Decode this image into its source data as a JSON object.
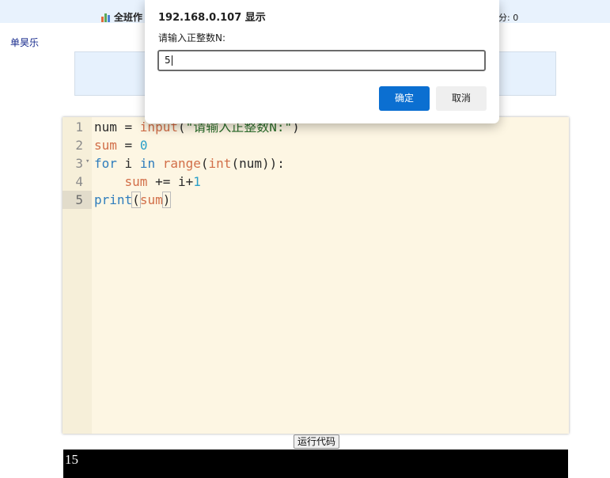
{
  "header": {
    "left_label": "全班作",
    "right_label": "分: 0"
  },
  "user": {
    "name": "单昊乐"
  },
  "dialog": {
    "title": "192.168.0.107 显示",
    "message": "请输入正整数N:",
    "input_value": "5",
    "ok_label": "确定",
    "cancel_label": "取消"
  },
  "editor": {
    "line_numbers": [
      "1",
      "2",
      "3",
      "4",
      "5"
    ],
    "active_line": 5,
    "lines": [
      "num = input(\"请输入正整数N:\")",
      "sum = 0",
      "for i in range(int(num)):",
      "    sum += i+1",
      "print(sum)"
    ]
  },
  "run_button": {
    "label": "运行代码"
  },
  "output": {
    "text": "15"
  },
  "colors": {
    "topbar_bg": "#e8f2fd",
    "editor_bg": "#fdf6e3",
    "keyword": "#2f7dbd",
    "function": "#d26f49",
    "number": "#2aa0c9",
    "primary_button": "#0b6fd1"
  }
}
